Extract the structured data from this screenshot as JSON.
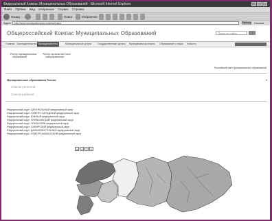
{
  "window": {
    "title": "Федеральный Компас Муниципальных Образований - Microsoft Internet Explorer",
    "controls": [
      "_",
      "□",
      "×"
    ]
  },
  "menu": [
    "Файл",
    "Правка",
    "Вид",
    "Избранное",
    "Сервис",
    "Справка"
  ],
  "toolbar": {
    "back": "Назад",
    "search": "Поиск",
    "favorites": "Избранное"
  },
  "address": {
    "label": "Адрес",
    "url": "http://www.municipalkompas.ru/default.aspx",
    "go": "Переход",
    "links": "Ссылки"
  },
  "site": {
    "title": "Общероссийский Компас Муниципальных Образований",
    "search_placeholder": "Поиск по сайту"
  },
  "nav": [
    "Главная",
    "Законодательство",
    "Муниципалитеты",
    "Муниципальные услуги",
    "Государственные органы",
    "Муниципальная власть",
    "Образование и наука",
    "Новости"
  ],
  "links": {
    "left1_a": "Реестр муниципальных",
    "left1_b": "образований",
    "left2_a": "Реестр органов местного",
    "left2_b": "самоуправления",
    "right": "Российский сайт муниципальных образований"
  },
  "section": {
    "title": "Муниципальные образования России",
    "lines": [
      "Список регионов",
      "Список районов"
    ]
  },
  "districts": [
    "Федеральный округ: ЦЕНТРАЛЬНЫЙ федеральный округ",
    "Федеральный округ: СЕВЕРО-ЗАПАДНЫЙ федеральный округ",
    "Федеральный округ: ЮЖНЫЙ федеральный округ",
    "Федеральный округ: ПРИВОЛЖСКИЙ федеральный округ",
    "Федеральный округ: УРАЛЬСКИЙ федеральный округ",
    "Федеральный округ: СИБИРСКИЙ федеральный округ",
    "Федеральный округ: ДАЛЬНЕВОСТОЧНЫЙ федеральный округ",
    "Федеральный округ: СЕВЕРО-КАВКАЗСКИЙ федеральный округ"
  ],
  "zoom": [
    "+",
    "−",
    "□",
    "⌂"
  ],
  "map_colors": {
    "northwest": "#6f6f6f",
    "central": "#9a9a9a",
    "volga": "#c6c6c6",
    "ural": "#f0f0f0",
    "siberia": "#b5b5b5",
    "fareast": "#a8a8a8",
    "south": "#7d7d7d"
  }
}
